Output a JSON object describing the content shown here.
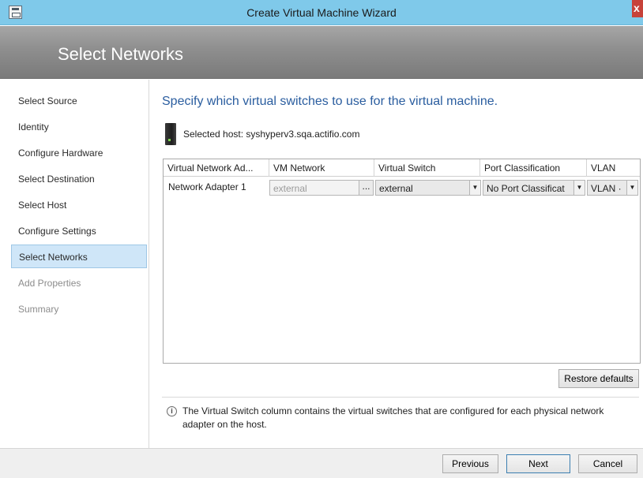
{
  "window": {
    "title": "Create Virtual Machine Wizard",
    "close_label": "x"
  },
  "header": {
    "title": "Select Networks"
  },
  "nav": {
    "items": [
      {
        "label": "Select Source",
        "state": "normal"
      },
      {
        "label": "Identity",
        "state": "normal"
      },
      {
        "label": "Configure Hardware",
        "state": "normal"
      },
      {
        "label": "Select Destination",
        "state": "normal"
      },
      {
        "label": "Select Host",
        "state": "normal"
      },
      {
        "label": "Configure Settings",
        "state": "normal"
      },
      {
        "label": "Select Networks",
        "state": "active"
      },
      {
        "label": "Add Properties",
        "state": "disabled"
      },
      {
        "label": "Summary",
        "state": "disabled"
      }
    ]
  },
  "main": {
    "heading": "Specify which virtual switches to use for the virtual machine.",
    "host_label": "Selected host:  syshyperv3.sqa.actifio.com",
    "grid": {
      "columns": [
        "Virtual Network Ad...",
        "VM Network",
        "Virtual Switch",
        "Port Classification",
        "VLAN"
      ],
      "rows": [
        {
          "adapter": "Network Adapter 1",
          "vm_network": "external",
          "browse": "...",
          "virtual_switch": "external",
          "port_classification": "No Port Classificat",
          "vlan": "VLAN ·"
        }
      ]
    },
    "restore_label": "Restore defaults",
    "info_text": "The Virtual Switch column contains the virtual switches that are configured for each physical network adapter on the host."
  },
  "footer": {
    "previous": "Previous",
    "next": "Next",
    "cancel": "Cancel"
  },
  "colors": {
    "titlebar": "#7fc9ea",
    "heading": "#2a5d9f",
    "nav_active": "#cfe6f8",
    "close": "#c7423a"
  }
}
